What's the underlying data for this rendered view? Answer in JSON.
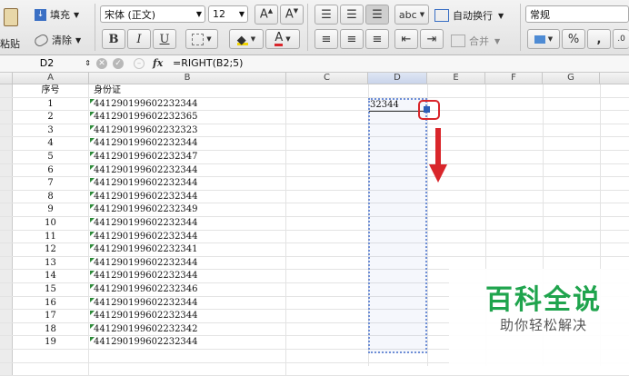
{
  "ribbon": {
    "paste_label": "粘贴",
    "fill_label": "填充",
    "clear_label": "清除",
    "font_name": "宋体 (正文)",
    "font_size": "12",
    "bold_label": "B",
    "italic_label": "I",
    "underline_label": "U",
    "abc_label": "abc",
    "wrap_label": "自动换行",
    "merge_label": "合并",
    "number_format": "常规",
    "percent_label": "%",
    "comma_label": ","
  },
  "formula_bar": {
    "cell_ref": "D2",
    "fx_label": "fx",
    "formula": "=RIGHT(B2;5)"
  },
  "columns": [
    "A",
    "B",
    "C",
    "D",
    "E",
    "F",
    "G"
  ],
  "table": {
    "header_a": "序号",
    "header_b": "身份证",
    "rows": [
      {
        "n": "1",
        "id": "441290199602232344",
        "d": "32344"
      },
      {
        "n": "2",
        "id": "441290199602232365",
        "d": ""
      },
      {
        "n": "3",
        "id": "441290199602232323",
        "d": ""
      },
      {
        "n": "4",
        "id": "441290199602232344",
        "d": ""
      },
      {
        "n": "5",
        "id": "441290199602232347",
        "d": ""
      },
      {
        "n": "6",
        "id": "441290199602232344",
        "d": ""
      },
      {
        "n": "7",
        "id": "441290199602232344",
        "d": ""
      },
      {
        "n": "8",
        "id": "441290199602232344",
        "d": ""
      },
      {
        "n": "9",
        "id": "441290199602232349",
        "d": ""
      },
      {
        "n": "10",
        "id": "441290199602232344",
        "d": ""
      },
      {
        "n": "11",
        "id": "441290199602232344",
        "d": ""
      },
      {
        "n": "12",
        "id": "441290199602232341",
        "d": ""
      },
      {
        "n": "13",
        "id": "441290199602232344",
        "d": ""
      },
      {
        "n": "14",
        "id": "441290199602232344",
        "d": ""
      },
      {
        "n": "15",
        "id": "441290199602232346",
        "d": ""
      },
      {
        "n": "16",
        "id": "441290199602232344",
        "d": ""
      },
      {
        "n": "17",
        "id": "441290199602232344",
        "d": ""
      },
      {
        "n": "18",
        "id": "441290199602232342",
        "d": ""
      },
      {
        "n": "19",
        "id": "441290199602232344",
        "d": ""
      }
    ]
  },
  "watermark": {
    "title": "百科全说",
    "subtitle": "助你轻松解决"
  },
  "colors": {
    "accent_red": "#d9262b",
    "selection_blue": "#6f8fd6",
    "watermark_green": "#1fa44d"
  }
}
